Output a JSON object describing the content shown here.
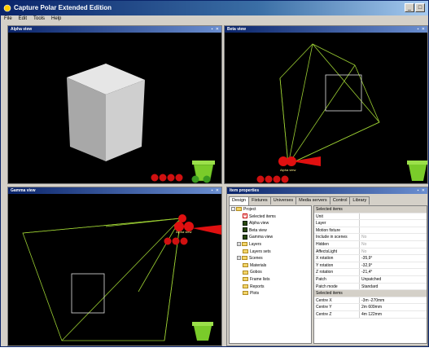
{
  "window": {
    "title": "Capture Polar Extended Edition"
  },
  "menu": [
    "File",
    "Edit",
    "Tools",
    "Help"
  ],
  "views": {
    "alpha": {
      "label": "Alpha view"
    },
    "beta": {
      "label": "Beta view"
    },
    "gamma": {
      "label": "Gamma view"
    }
  },
  "scene_labels": {
    "camera": "Alpha view"
  },
  "properties": {
    "header": "Item properties",
    "tabs": [
      "Design",
      "Fixtures",
      "Universes",
      "Media servers",
      "Control",
      "Library"
    ],
    "active_tab": 0,
    "tree": [
      {
        "label": "Project",
        "type": "folder",
        "indent": 0,
        "exp": "-"
      },
      {
        "label": "Selected items",
        "type": "sel",
        "indent": 2
      },
      {
        "label": "Alpha view",
        "type": "view",
        "indent": 2
      },
      {
        "label": "Beta view",
        "type": "view",
        "indent": 2
      },
      {
        "label": "Gamma view",
        "type": "view",
        "indent": 2
      },
      {
        "label": "Layers",
        "type": "folder",
        "indent": 1,
        "exp": "+"
      },
      {
        "label": "Layers sets",
        "type": "folder",
        "indent": 2
      },
      {
        "label": "Scenes",
        "type": "folder",
        "indent": 1,
        "exp": "+"
      },
      {
        "label": "Materials",
        "type": "folder",
        "indent": 2
      },
      {
        "label": "Gobos",
        "type": "folder",
        "indent": 2
      },
      {
        "label": "Frame lists",
        "type": "folder",
        "indent": 2
      },
      {
        "label": "Reports",
        "type": "folder",
        "indent": 2
      },
      {
        "label": "Plots",
        "type": "folder",
        "indent": 2
      }
    ],
    "grid": [
      {
        "k": "Selected items",
        "section": true
      },
      {
        "k": "Unit",
        "v": ""
      },
      {
        "k": "Layer",
        "v": ""
      },
      {
        "k": "Motion fixture",
        "v": ""
      },
      {
        "k": "Include in scenes",
        "v": "No",
        "dim": true
      },
      {
        "k": "Hidden",
        "v": "No",
        "dim": true
      },
      {
        "k": "AffectsLight",
        "v": "No",
        "dim": true
      },
      {
        "k": "X rotation",
        "v": "-35,9°"
      },
      {
        "k": "Y rotation",
        "v": "-32,9°"
      },
      {
        "k": "Z rotation",
        "v": "-21,4°"
      },
      {
        "k": "Patch",
        "v": "Unpatched"
      },
      {
        "k": "Patch mode",
        "v": "Standard"
      },
      {
        "k": "Selected items",
        "section": true
      },
      {
        "k": "Centre X",
        "v": "-3m -270mm"
      },
      {
        "k": "Centre Y",
        "v": "2m 609mm"
      },
      {
        "k": "Centre Z",
        "v": "4m 122mm"
      }
    ]
  },
  "colors": {
    "wire": "#9acd32",
    "fixture": "#e01010",
    "title_start": "#0a246a"
  },
  "icons": [
    "app-icon",
    "minimize-icon",
    "maximize-icon",
    "folder-icon",
    "view-icon",
    "trash-icon",
    "zoom-in-icon",
    "zoom-out-icon",
    "rotate-icon"
  ]
}
